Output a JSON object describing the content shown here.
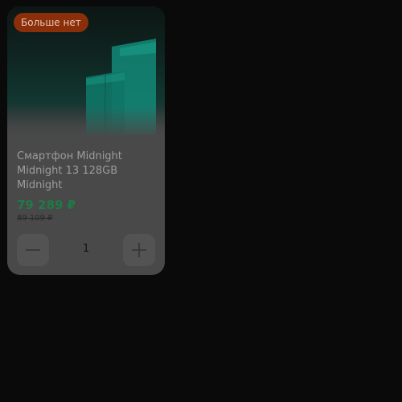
{
  "product_card": {
    "badge": "Больше нет",
    "title": "Смартфон Midnight Midnight 13 128GB Midnight",
    "price": "79 289 ₽",
    "old_price": "89 109 ₽",
    "quantity": "1",
    "image_icon": "product-image-placeholder"
  },
  "colors": {
    "page_background": "#0a0a0a",
    "card_background": "#494949",
    "badge_background": "#8b2f0a",
    "badge_text": "#e9c7b6",
    "price_text": "#1f7a46",
    "image_accent": "#138a78"
  },
  "icons": {
    "minus": "minus-icon",
    "plus": "plus-icon"
  }
}
